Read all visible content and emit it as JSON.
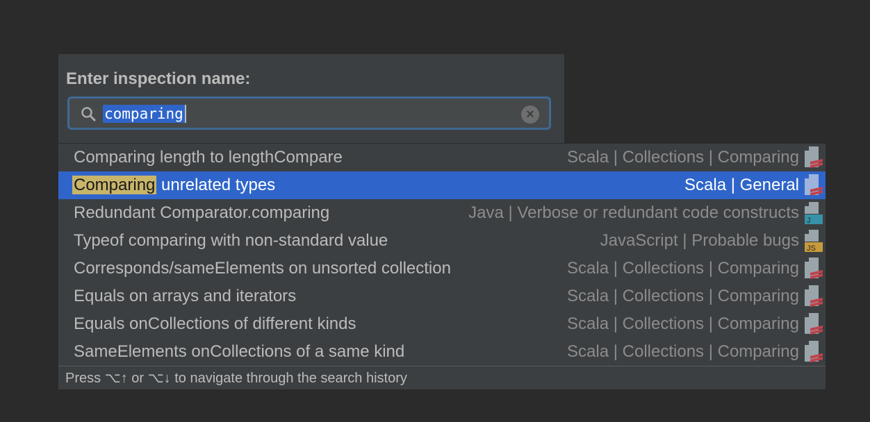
{
  "dialog": {
    "title": "Enter inspection name:",
    "search_value": "comparing",
    "search_icon": "magnifier-icon",
    "clear_icon": "clear-circle-icon"
  },
  "results": [
    {
      "name": "Comparing length to lengthCompare",
      "category": "Scala | Collections | Comparing",
      "icon": "scala"
    },
    {
      "highlight": "Comparing",
      "name_rest": " unrelated types",
      "category": "Scala | General",
      "icon": "scala",
      "selected": true
    },
    {
      "name": "Redundant Comparator.comparing",
      "category": "Java | Verbose or redundant code constructs",
      "icon": "java"
    },
    {
      "name": "Typeof comparing with non-standard value",
      "category": "JavaScript | Probable bugs",
      "icon": "js"
    },
    {
      "name": "Corresponds/sameElements on unsorted collection",
      "category": "Scala | Collections | Comparing",
      "icon": "scala"
    },
    {
      "name": "Equals on arrays and iterators",
      "category": "Scala | Collections | Comparing",
      "icon": "scala"
    },
    {
      "name": "Equals onCollections of different kinds",
      "category": "Scala | Collections | Comparing",
      "icon": "scala"
    },
    {
      "name": "SameElements onCollections of a same kind",
      "category": "Scala | Collections | Comparing",
      "icon": "scala"
    }
  ],
  "footer": "Press ⌥↑ or ⌥↓ to navigate through the search history",
  "colors": {
    "selection": "#2f65ca",
    "highlight": "#c8b569",
    "java": "#3592a8",
    "js": "#c79a3c",
    "scala": "#c0424c"
  }
}
